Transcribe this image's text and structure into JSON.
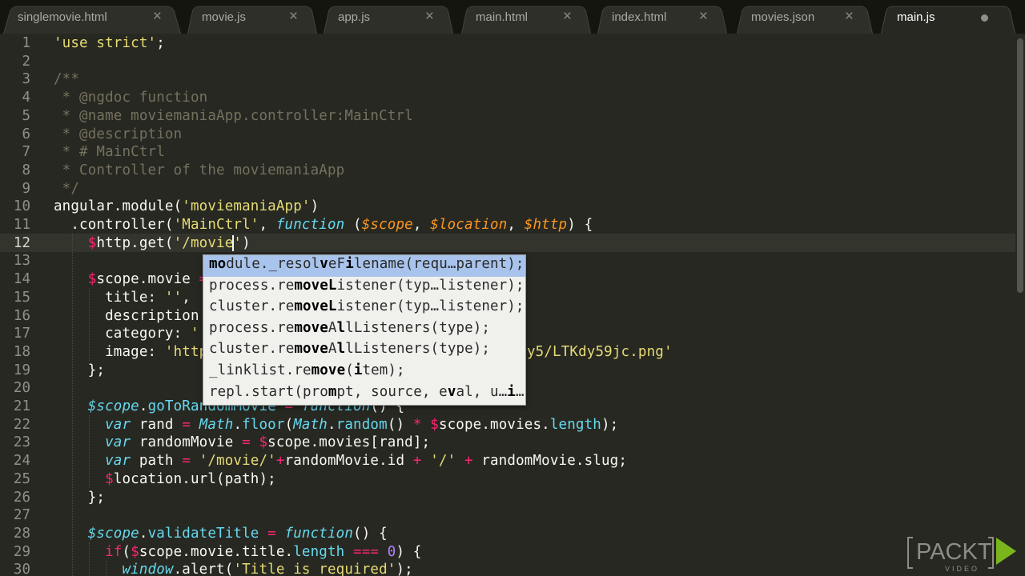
{
  "tabs": [
    {
      "label": "singlemovie.html",
      "active": false
    },
    {
      "label": "movie.js",
      "active": false
    },
    {
      "label": "app.js",
      "active": false
    },
    {
      "label": "main.html",
      "active": false
    },
    {
      "label": "index.html",
      "active": false
    },
    {
      "label": "movies.json",
      "active": false
    },
    {
      "label": "main.js",
      "active": true,
      "dirty": true
    }
  ],
  "tab_close_glyph": "×",
  "current_line": 12,
  "line_numbers": [
    "1",
    "2",
    "3",
    "4",
    "5",
    "6",
    "7",
    "8",
    "9",
    "10",
    "11",
    "12",
    "13",
    "14",
    "15",
    "16",
    "17",
    "18",
    "19",
    "20",
    "21",
    "22",
    "23",
    "24",
    "25",
    "26",
    "27",
    "28",
    "29",
    "30"
  ],
  "code_lines": [
    "'use strict';",
    "",
    "/**",
    " * @ngdoc function",
    " * @name moviemaniaApp.controller:MainCtrl",
    " * @description",
    " * # MainCtrl",
    " * Controller of the moviemaniaApp",
    " */",
    "angular.module('moviemaniaApp')",
    "  .controller('MainCtrl', function ($scope, $location, $http) {",
    "    $http.get('/movie')",
    "",
    "    $scope.movie = ",
    "      title: '',",
    "      description",
    "      category: '",
    "      image: 'http",
    "    };",
    "",
    "    $scope.goToRandomMovie = function() {",
    "      var rand = Math.floor(Math.random() * $scope.movies.length);",
    "      var randomMovie = $scope.movies[rand];",
    "      var path = '/movie/'+randomMovie.id + '/' + randomMovie.slug;",
    "      $location.url(path);",
    "    };",
    "",
    "    $scope.validateTitle = function() {",
    "      if($scope.movie.title.length === 0) {",
    "        window.alert('Title is required');"
  ],
  "line18_tail": "y5/LTKdy59jc.png'",
  "autocomplete": [
    "module._resolveFilename(requ…parent);",
    "process.removeListener(typ…listener);",
    "cluster.removeListener(typ…listener);",
    "process.removeAllListeners(type);",
    "cluster.removeAllListeners(type);",
    "_linklist.remove(item);",
    "repl.start(prompt, source, eval, u…i…"
  ],
  "watermark": {
    "brand": "PACKT",
    "sub": "VIDEO"
  },
  "colors": {
    "background": "#272822",
    "string": "#e6db74",
    "comment": "#75715e",
    "keyword": "#66d9ef",
    "operator": "#f92672",
    "param": "#fd971f",
    "function": "#a6e22e",
    "number": "#ae81ff",
    "popup_selected": "#a9c4ec"
  }
}
